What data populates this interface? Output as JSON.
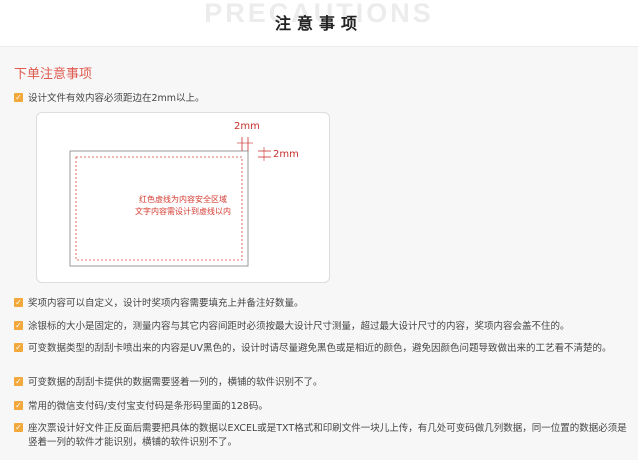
{
  "header": {
    "watermark": "PRECAUTIONS",
    "title": "注意事项"
  },
  "section": {
    "title": "下单注意事项"
  },
  "items": [
    "设计文件有效内容必须距边在2mm以上。",
    "奖项内容可以自定义，设计时奖项内容需要填充上并备注好数量。",
    "涂银标的大小是固定的，测量内容与其它内容间距时必须按最大设计尺寸测量，超过最大设计尺寸的内容，奖项内容会盖不住的。",
    "可变数据类型的刮刮卡喷出来的内容是UV黑色的，设计时请尽量避免黑色或是相近的颜色，避免因颜色问题导致做出来的工艺看不清楚的。",
    "可变数据的刮刮卡提供的数据需要竖着一列的，横铺的软件识别不了。",
    "常用的微信支付码/支付宝支付码是条形码里面的128码。",
    "座次票设计好文件正反面后需要把具体的数据以EXCEL或是TXT格式和印刷文件一块儿上传，有几处可变码做几列数据，同一位置的数据必须是竖着一列的软件才能识别，横铺的软件识别不了。"
  ],
  "diagram": {
    "label_top": "2mm",
    "label_right": "2mm",
    "note_line1": "红色虚线为内容安全区域",
    "note_line2": "文字内容需设计到虚线以内"
  },
  "colors": {
    "accent": "#e05a4f",
    "check": "#f2a83b",
    "guide": "#c8302c"
  },
  "icons": {
    "check": "checkbox-checked-icon"
  }
}
